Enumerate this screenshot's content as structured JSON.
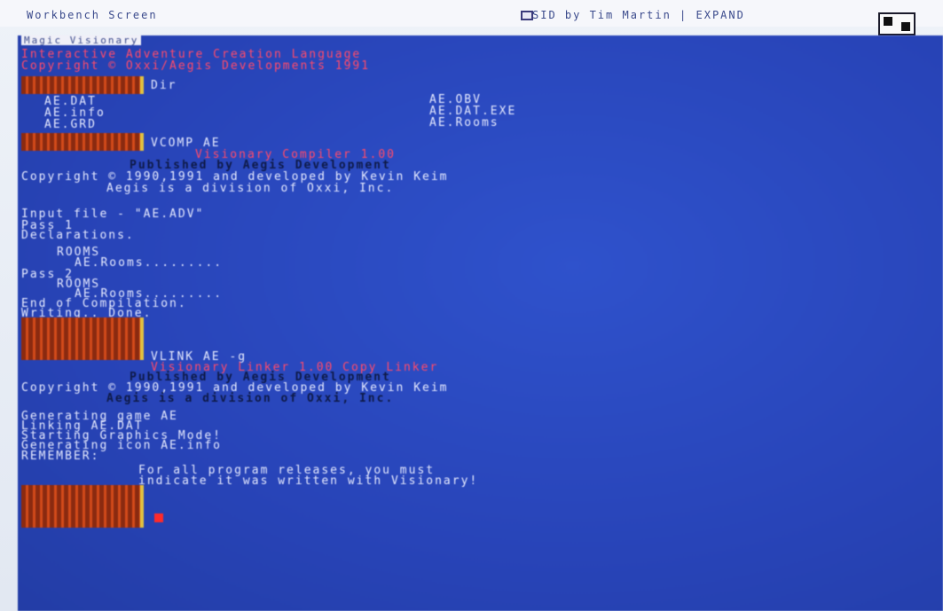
{
  "titlebar": {
    "screen_title": "Workbench Screen",
    "window_title": "Magic Visionary",
    "right_text": "SID by Tim Martin | EXPAND",
    "gadgets": [
      "zoom-gadget",
      "depth-gadget"
    ]
  },
  "console": {
    "header_red": [
      "Interactive Adventure Creation Language",
      "Copyright © Oxxi/Aegis Developments 1991"
    ],
    "dir_command": "Dir",
    "dir_left": [
      "AE.DAT",
      "AE.info",
      "AE.GRD"
    ],
    "dir_right": [
      "AE.OBV",
      "AE.DAT.EXE",
      "AE.Rooms"
    ],
    "vcomp_command": "VCOMP AE",
    "compiler_red": "Visionary Compiler 1.00",
    "published": "Published by Aegis Development",
    "copyright_line": "Copyright © 1990,1991 and developed by Kevin Keim",
    "division": "Aegis is a division of Oxxi, Inc.",
    "input_file": "Input file - \"AE.ADV\"",
    "pass1": "Pass 1",
    "declarations": "Declarations.",
    "rooms1": "ROOMS",
    "rooms1_file": "AE.Rooms.........",
    "pass2": "Pass 2",
    "rooms2": "ROOMS",
    "rooms2_file": "AE.Rooms.........",
    "end_compilation": "End of Compilation.",
    "writing_done": "Writing.. Done.",
    "vlink_command": "VLINK AE -g",
    "linker_red": "Visionary Linker 1.00 Copy Linker",
    "published2": "Published by Aegis Development",
    "copyright_line2": "Copyright © 1990,1991 and developed by Kevin Keim",
    "division2": "Aegis is a division of Oxxi, Inc.",
    "gen_lines": [
      "Generating game AE",
      "Linking AE.DAT",
      "Starting Graphics Mode!",
      "Generating icon AE.info"
    ],
    "remember": "REMEMBER:",
    "release_msg": "For all program releases, you must",
    "release_msg2": "indicate it was written with Visionary!"
  },
  "colors": {
    "console_bg": "#2a48c0",
    "text": "#d8def6",
    "highlight": "#ff4a6a",
    "prompt": "#d24a1a"
  }
}
